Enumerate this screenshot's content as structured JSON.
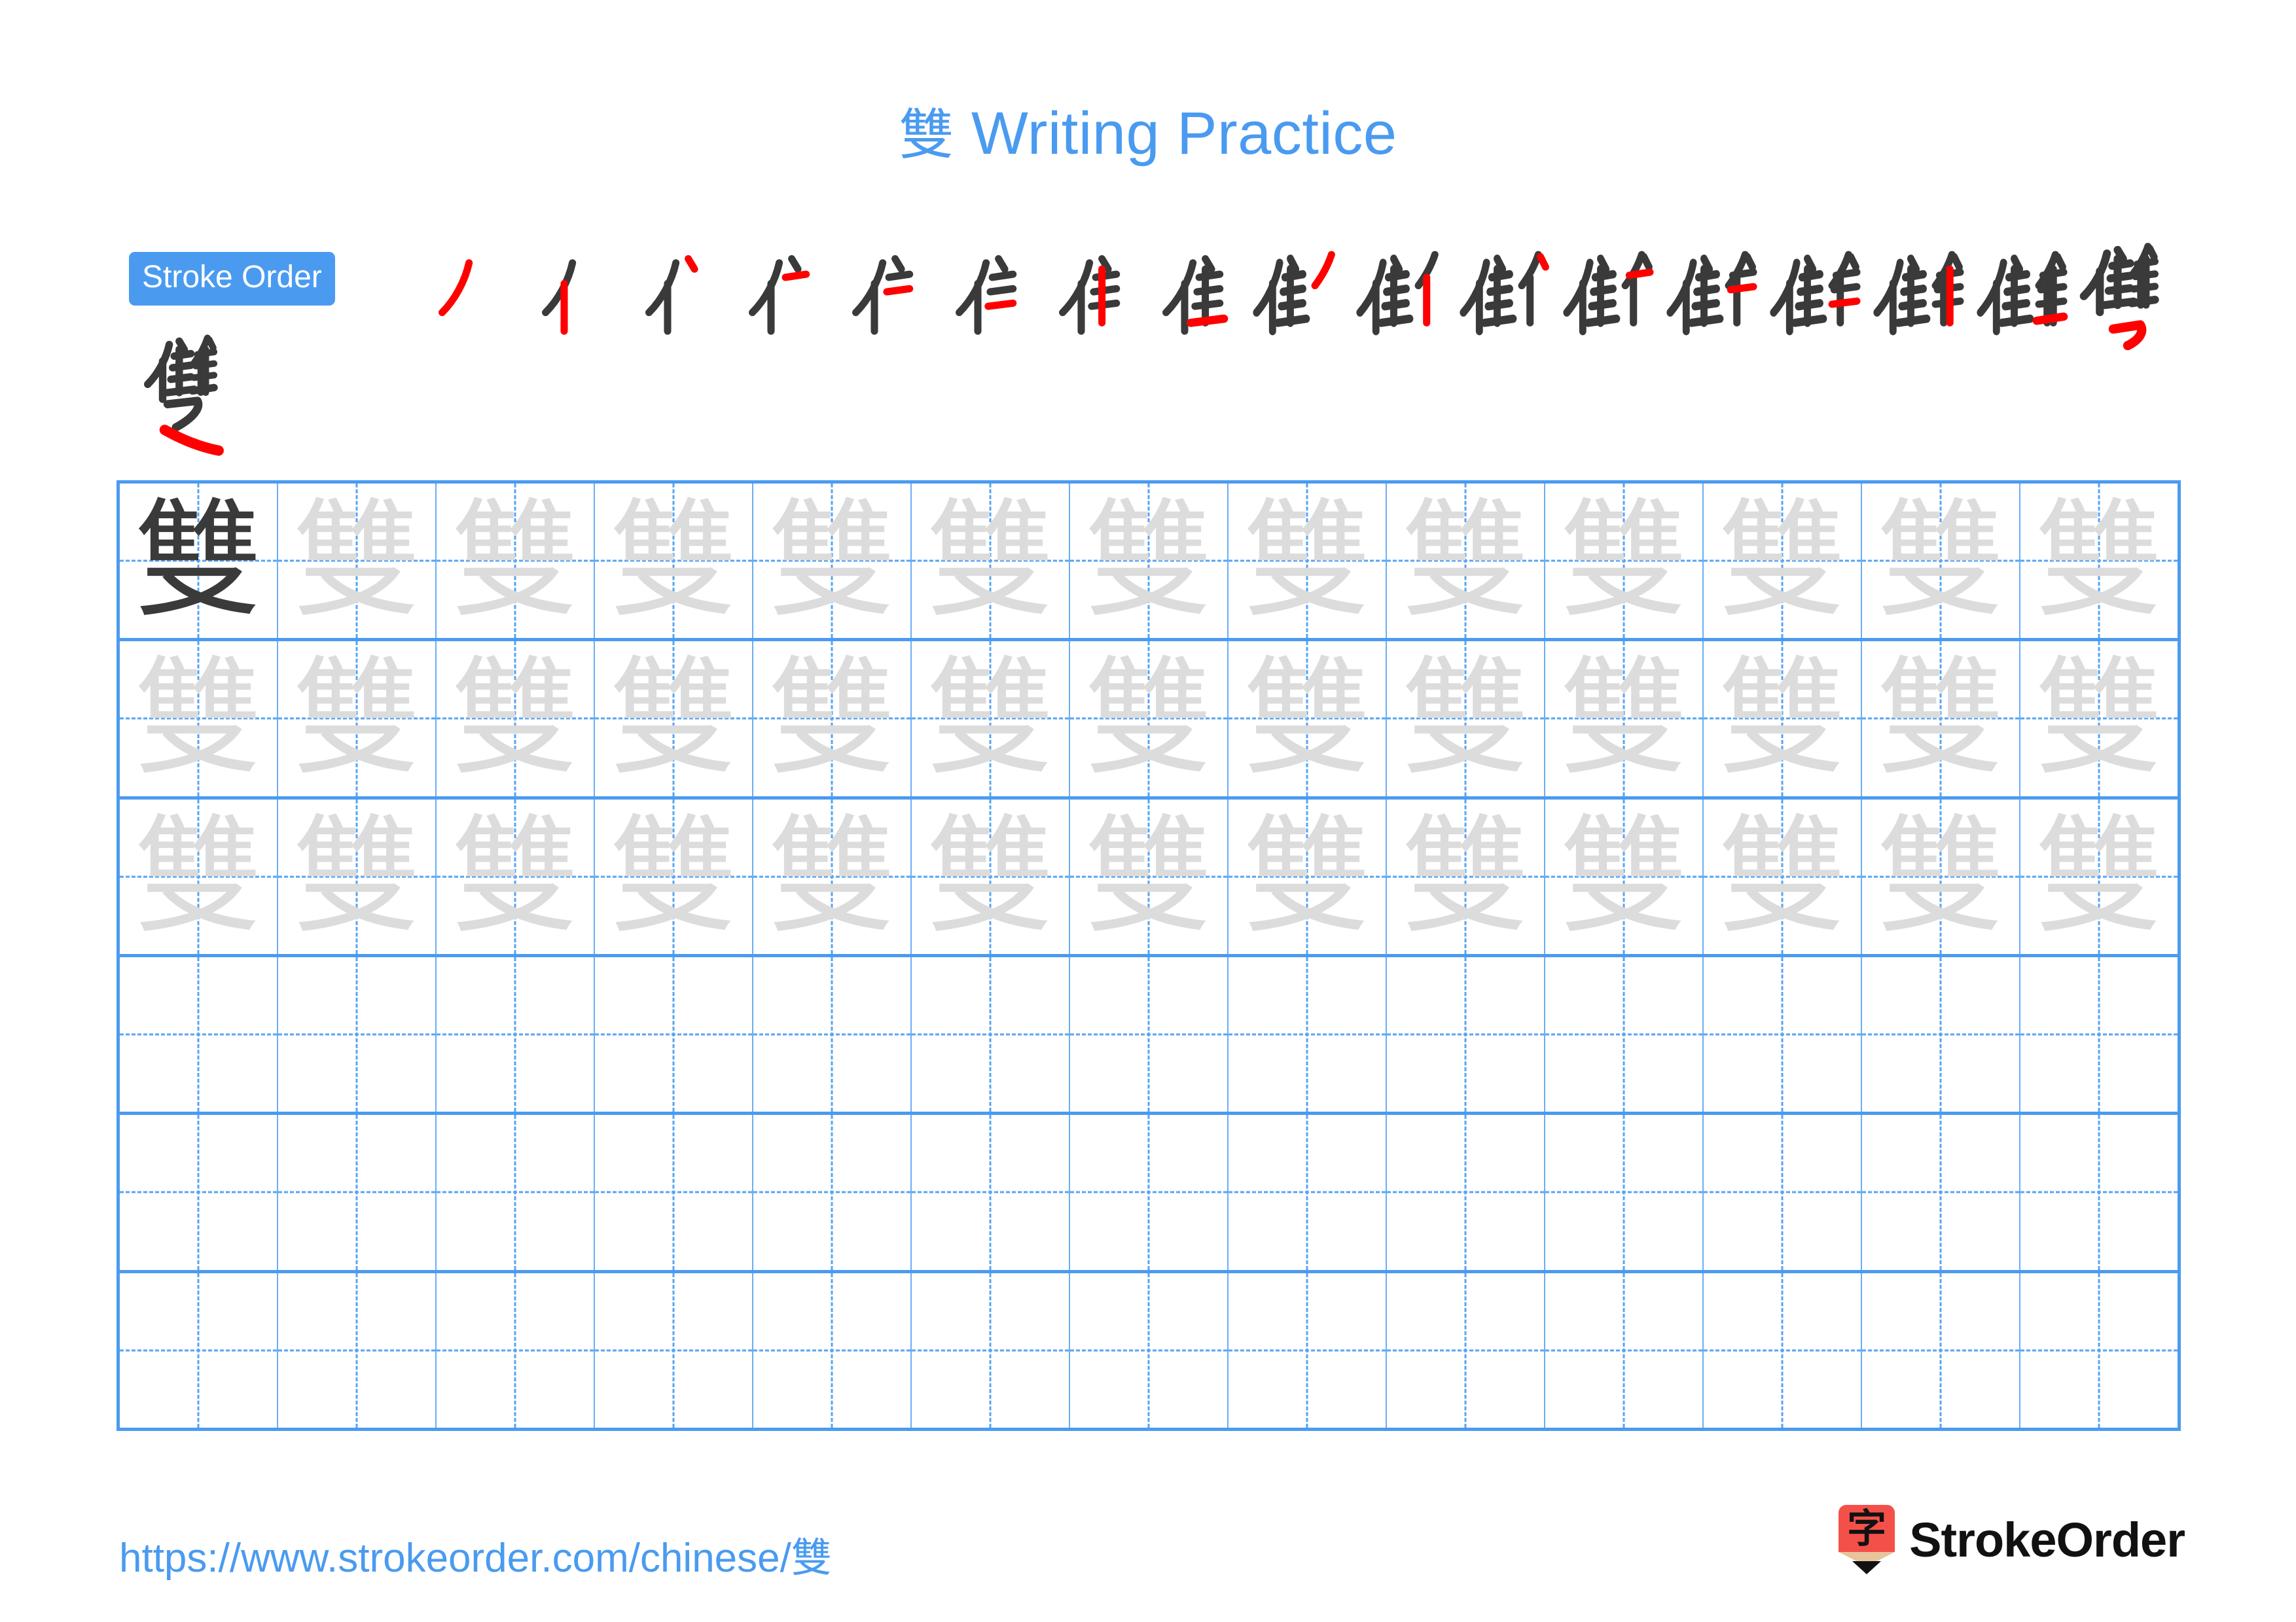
{
  "page": {
    "character": "雙",
    "title_prefix": "雙",
    "title_text": " Writing Practice",
    "accent_color": "#4a9bf0",
    "grid_line_color": "#4a9bf0",
    "guide_line_color": "#57a4f1",
    "trace_color": "#dcdcdc",
    "ink_color": "#3a3a3a",
    "new_stroke_color": "#ff0000"
  },
  "stroke_order": {
    "badge_label": "Stroke Order",
    "total_strokes": 18,
    "row1_count": 17,
    "row2_count": 1,
    "steps": [
      {
        "index": 1,
        "label": "丿"
      },
      {
        "index": 2,
        "label": "亻"
      },
      {
        "index": 3,
        "label": "亻丶"
      },
      {
        "index": 4,
        "label": "亻丶一"
      },
      {
        "index": 5,
        "label": "仨"
      },
      {
        "index": 6,
        "label": "仨一"
      },
      {
        "index": 7,
        "label": "隹"
      },
      {
        "index": 8,
        "label": "隹一"
      },
      {
        "index": 9,
        "label": "隹丿"
      },
      {
        "index": 10,
        "label": "隹亻"
      },
      {
        "index": 11,
        "label": "雔丶"
      },
      {
        "index": 12,
        "label": "雔一"
      },
      {
        "index": 13,
        "label": "雔二"
      },
      {
        "index": 14,
        "label": "雔三"
      },
      {
        "index": 15,
        "label": "雔丨"
      },
      {
        "index": 16,
        "label": "雔一"
      },
      {
        "index": 17,
        "label": "雔乛"
      },
      {
        "index": 18,
        "label": "雙"
      }
    ]
  },
  "practice_grid": {
    "columns": 13,
    "rows": 6,
    "row_modes": [
      "first-dark-rest-trace",
      "all-trace",
      "all-trace",
      "blank",
      "blank",
      "blank"
    ],
    "cell_character": "雙"
  },
  "footer": {
    "url": "https://www.strokeorder.com/chinese/",
    "url_character": "雙",
    "brand_name": "StrokeOrder",
    "brand_mark_character": "字"
  }
}
